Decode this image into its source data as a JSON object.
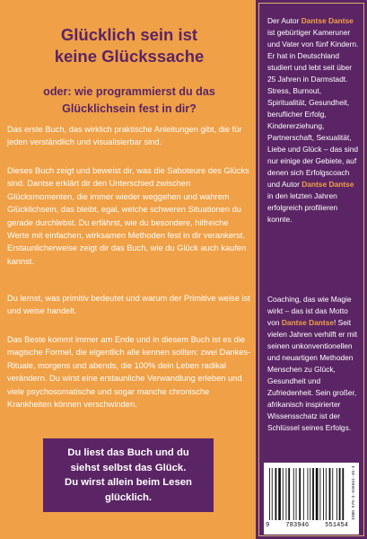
{
  "left": {
    "title_lines": [
      "Glücklich sein ist",
      "keine Glückssache"
    ],
    "subtitle_lines": [
      "oder: wie programmierst du das",
      "Glücklichsein fest in dir?"
    ],
    "paragraphs": [
      "Das erste Buch, das wirklich praktische Anleitungen gibt, die für jeden verständlich und visualisierbar sind.",
      "Dieses Buch zeigt und beweist dir, was die Saboteure des Glücks sind. Dantse erklärt dir den Unterschied zwischen Glücksmomenten, die immer wieder weggehen und wahrem Glücklichsein, das bleibt, egal, welche schweren Situationen du gerade durchlebst. Du erfährst, wie du besondere, hilfreiche Werte mit einfachen, wirksamen Methoden fest in dir verankerst. Erstaunlicherweise zeigt dir das Buch, wie du Glück auch kaufen kannst.",
      "Du lernst, was primitiv bedeutet und warum der Primitive weise ist und weise handelt.",
      "Das Beste kommt immer am Ende und in diesem Buch ist es die magische Formel, die eigentlich alle kennen sollten: zwei Dankes-Rituale, morgens und abends, die 100% dein Leben radikal verändern. Du wirst eine erstaunliche Verwandlung erleben und viele psychosomatische und sogar manche chronische Krankheiten können verschwinden."
    ],
    "callout_lines": [
      "Du liest das Buch und du",
      "siehst selbst das Glück.",
      "Du wirst allein beim Lesen",
      "glücklich."
    ]
  },
  "right": {
    "bio": {
      "pre": "Der Autor ",
      "name1": "Dantse Dantse",
      "mid": " ist gebürtiger Kameruner und Vater von fünf Kindern. Er hat in Deutschland studiert und lebt seit über 25 Jahren in Darmstadt. Stress, Burnout, Spiritualität, Gesundheit, beruflicher Erfolg, Kindererziehung, Partnerschaft, Sexualität, Liebe und Glück – das sind nur einige der Gebiete, auf denen sich Erfolgscoach und Autor ",
      "name2": "Dantse Dantse",
      "post": " in den letzten Jahren erfolgreich profilieren konnte."
    },
    "coaching": {
      "pre": "Coaching, das wie Magie wirkt – das ist das Motto von ",
      "name": "Dantse Dantse",
      "post": "! Seit vielen Jahren verhilft er mit seinen unkonventionellen und neuartigen Methoden Menschen zu Glück, Gesundheit und Zufriedenheit. Sein großer, afrikanisch inspirierter Wissensschatz ist der Schlüssel seines Erfolgs."
    },
    "isbn_label": "ISBN 978-3-946551-45-4",
    "barcode_digits": [
      "9",
      "783946",
      "551454"
    ]
  },
  "colors": {
    "background_orange": "#f0a046",
    "panel_purple": "#5b2565",
    "text_white": "#ffffff"
  }
}
